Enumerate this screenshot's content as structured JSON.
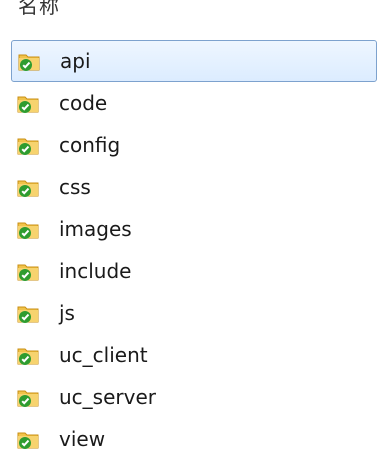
{
  "top_fragment": "名称",
  "list": {
    "items": [
      {
        "name": "api",
        "selected": true,
        "icon": "folder-check-icon"
      },
      {
        "name": "code",
        "selected": false,
        "icon": "folder-check-icon"
      },
      {
        "name": "config",
        "selected": false,
        "icon": "folder-check-icon"
      },
      {
        "name": "css",
        "selected": false,
        "icon": "folder-check-icon"
      },
      {
        "name": "images",
        "selected": false,
        "icon": "folder-check-icon"
      },
      {
        "name": "include",
        "selected": false,
        "icon": "folder-check-icon"
      },
      {
        "name": "js",
        "selected": false,
        "icon": "folder-check-icon"
      },
      {
        "name": "uc_client",
        "selected": false,
        "icon": "folder-check-icon"
      },
      {
        "name": "uc_server",
        "selected": false,
        "icon": "folder-check-icon"
      },
      {
        "name": "view",
        "selected": false,
        "icon": "folder-check-icon"
      }
    ]
  },
  "colors": {
    "folder": "#f1c34a",
    "folder_shadow": "#d89b21",
    "check": "#2f9c2f",
    "selected_border": "#7da2ce",
    "selected_bg": "#dcecff"
  }
}
